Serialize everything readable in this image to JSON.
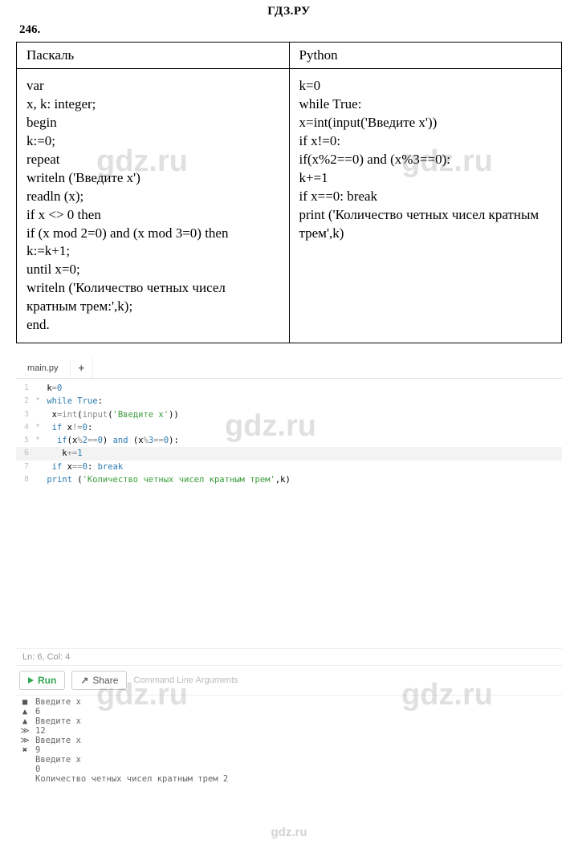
{
  "header": {
    "site": "ГДЗ.РУ",
    "exercise": "246."
  },
  "table": {
    "headers": [
      "Паскаль",
      "Python"
    ],
    "pascal": "var\nx, k: integer;\nbegin\nk:=0;\nrepeat\nwriteln ('Введите x')\nreadln (x);\nif x <> 0 then\nif (x mod 2=0) and (x mod 3=0) then\nk:=k+1;\nuntil x=0;\nwriteln ('Количество четных чисел\nкратным трем:',k);\nend.",
    "python": "k=0\nwhile True:\nx=int(input('Введите x'))\nif x!=0:\nif(x%2==0) and (x%3==0):\nk+=1\nif x==0: break\nprint ('Количество четных чисел кратным\nтрем',k)"
  },
  "watermarks": {
    "w1": "gdz.ru",
    "w2": "gdz.ru",
    "w3": "gdz.ru",
    "w4": "gdz.ru",
    "w5": "gdz.ru",
    "footer": "gdz.ru"
  },
  "editor": {
    "tab_name": "main.py",
    "tab_plus": "+",
    "lines": [
      {
        "n": "1",
        "fold": "",
        "tokens": [
          {
            "t": " k",
            "c": ""
          },
          {
            "t": "=",
            "c": "op"
          },
          {
            "t": "0",
            "c": "num"
          }
        ]
      },
      {
        "n": "2",
        "fold": "▾",
        "tokens": [
          {
            "t": " ",
            "c": ""
          },
          {
            "t": "while",
            "c": "kw"
          },
          {
            "t": " ",
            "c": ""
          },
          {
            "t": "True",
            "c": "kw"
          },
          {
            "t": ":",
            "c": ""
          }
        ]
      },
      {
        "n": "3",
        "fold": "",
        "tokens": [
          {
            "t": "  x",
            "c": ""
          },
          {
            "t": "=",
            "c": "op"
          },
          {
            "t": "int",
            "c": "fn"
          },
          {
            "t": "(",
            "c": ""
          },
          {
            "t": "input",
            "c": "fn"
          },
          {
            "t": "(",
            "c": ""
          },
          {
            "t": "'Введите x'",
            "c": "sg"
          },
          {
            "t": "))",
            "c": ""
          }
        ]
      },
      {
        "n": "4",
        "fold": "▾",
        "tokens": [
          {
            "t": "  ",
            "c": ""
          },
          {
            "t": "if",
            "c": "kw"
          },
          {
            "t": " x",
            "c": ""
          },
          {
            "t": "!=",
            "c": "op"
          },
          {
            "t": "0",
            "c": "num"
          },
          {
            "t": ":",
            "c": ""
          }
        ]
      },
      {
        "n": "5",
        "fold": "▾",
        "tokens": [
          {
            "t": "   ",
            "c": ""
          },
          {
            "t": "if",
            "c": "kw"
          },
          {
            "t": "(x",
            "c": ""
          },
          {
            "t": "%",
            "c": "op"
          },
          {
            "t": "2",
            "c": "num"
          },
          {
            "t": "==",
            "c": "op"
          },
          {
            "t": "0",
            "c": "num"
          },
          {
            "t": ") ",
            "c": ""
          },
          {
            "t": "and",
            "c": "kw"
          },
          {
            "t": " (x",
            "c": ""
          },
          {
            "t": "%",
            "c": "op"
          },
          {
            "t": "3",
            "c": "num"
          },
          {
            "t": "==",
            "c": "op"
          },
          {
            "t": "0",
            "c": "num"
          },
          {
            "t": "):",
            "c": ""
          }
        ]
      },
      {
        "n": "6",
        "fold": "",
        "hl": true,
        "tokens": [
          {
            "t": "    k",
            "c": ""
          },
          {
            "t": "+=",
            "c": "op"
          },
          {
            "t": "1",
            "c": "num"
          }
        ]
      },
      {
        "n": "7",
        "fold": "",
        "tokens": [
          {
            "t": "  ",
            "c": ""
          },
          {
            "t": "if",
            "c": "kw"
          },
          {
            "t": " x",
            "c": ""
          },
          {
            "t": "==",
            "c": "op"
          },
          {
            "t": "0",
            "c": "num"
          },
          {
            "t": ": ",
            "c": ""
          },
          {
            "t": "break",
            "c": "kw"
          }
        ]
      },
      {
        "n": "8",
        "fold": "",
        "tokens": [
          {
            "t": " ",
            "c": ""
          },
          {
            "t": "print",
            "c": "kw"
          },
          {
            "t": " (",
            "c": ""
          },
          {
            "t": "'Количество четных чисел кратным трем'",
            "c": "sg"
          },
          {
            "t": ",k)",
            "c": ""
          }
        ]
      }
    ],
    "status": "Ln: 6, Col: 4",
    "run_label": "Run",
    "share_label": "Share",
    "cli_label": "Command Line Arguments"
  },
  "console": {
    "rows": [
      {
        "icon": "■",
        "text": "Введите x"
      },
      {
        "icon": "▲",
        "text": "6"
      },
      {
        "icon": "▲",
        "text": "Введите x"
      },
      {
        "icon": "≫",
        "text": "12"
      },
      {
        "icon": "≫",
        "text": "Введите x"
      },
      {
        "icon": "✖",
        "text": "9"
      },
      {
        "icon": "",
        "text": "Введите x"
      },
      {
        "icon": "",
        "text": "0"
      },
      {
        "icon": "",
        "text": "Количество четных чисел кратным трем 2"
      }
    ]
  }
}
